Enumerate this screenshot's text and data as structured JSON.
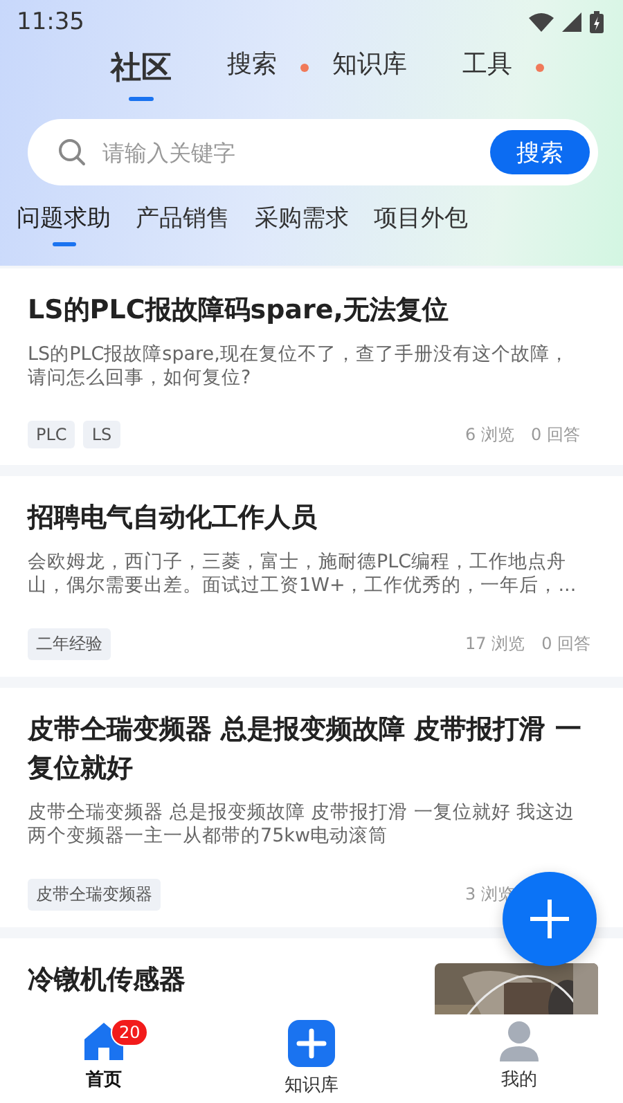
{
  "status_bar": {
    "time": "11:35"
  },
  "top_tabs": [
    {
      "label": "社区",
      "selected": true,
      "dot": false
    },
    {
      "label": "搜索",
      "selected": false,
      "dot": true
    },
    {
      "label": "知识库",
      "selected": false,
      "dot": false
    },
    {
      "label": "工具",
      "selected": false,
      "dot": true
    }
  ],
  "search": {
    "placeholder": "请输入关键字",
    "button": "搜索"
  },
  "categories": [
    {
      "label": "问题求助",
      "selected": true
    },
    {
      "label": "产品销售",
      "selected": false
    },
    {
      "label": "采购需求",
      "selected": false
    },
    {
      "label": "项目外包",
      "selected": false
    }
  ],
  "posts": [
    {
      "title": "LS的PLC报故障码spare,无法复位",
      "body": "LS的PLC报故障spare,现在复位不了，查了手册没有这个故障，请问怎么回事，如何复位?",
      "tags": [
        "PLC",
        "LS"
      ],
      "views": "6 浏览",
      "answers": "0 回答"
    },
    {
      "title": "招聘电气自动化工作人员",
      "body": "会欧姆龙，西门子，三菱，富士，施耐德PLC编程，工作地点舟山，偶尔需要出差。面试过工资1W+，工作优秀的，一年后，...",
      "tags": [
        "二年经验"
      ],
      "views": "17 浏览",
      "answers": "0 回答"
    },
    {
      "title": "皮带仝瑞变频器 总是报变频故障 皮带报打滑 一复位就好",
      "body": "皮带仝瑞变频器 总是报变频故障 皮带报打滑 一复位就好 我这边两个变频器一主一从都带的75kw电动滚筒",
      "tags": [
        "皮带仝瑞变频器"
      ],
      "views": "3 浏览"
    },
    {
      "title": "冷镦机传感器"
    }
  ],
  "bottom_nav": [
    {
      "kind": "home",
      "label": "首页",
      "badge": "20",
      "selected": true
    },
    {
      "kind": "add",
      "label": "知识库",
      "selected": false
    },
    {
      "kind": "person",
      "label": "我的",
      "selected": false
    }
  ]
}
